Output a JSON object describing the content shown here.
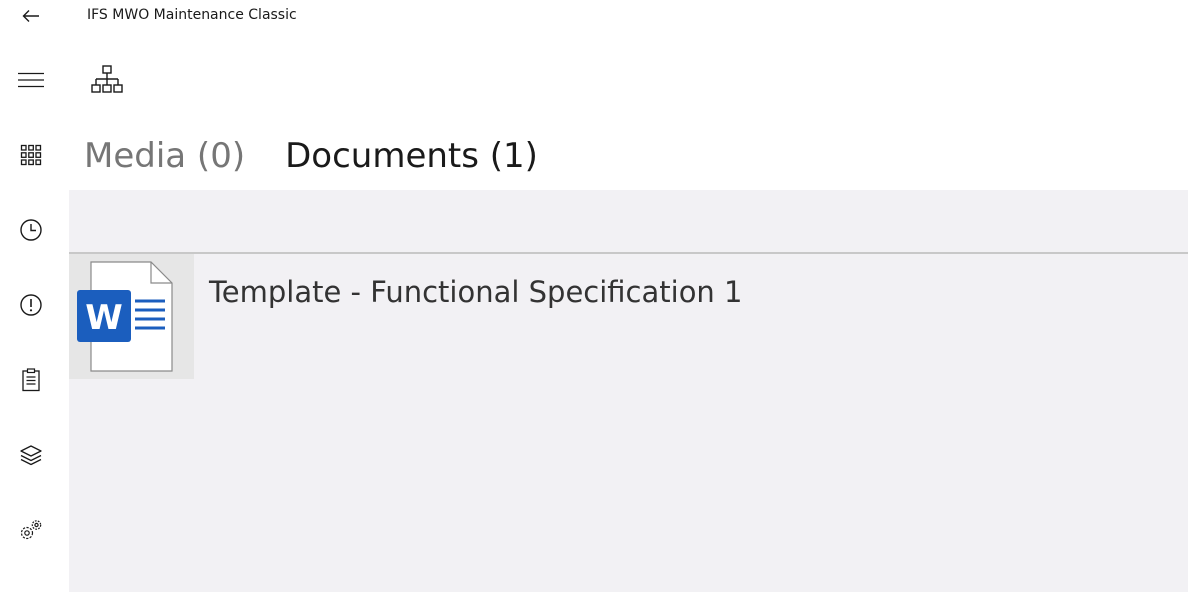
{
  "titlebar": {
    "title": "IFS MWO Maintenance Classic",
    "back_icon": "arrow-left-icon"
  },
  "nav_rail": {
    "items": [
      {
        "icon": "hamburger-menu-icon"
      },
      {
        "icon": "app-grid-icon"
      },
      {
        "icon": "clock-icon"
      },
      {
        "icon": "alert-circle-icon"
      },
      {
        "icon": "clipboard-icon"
      },
      {
        "icon": "layers-icon"
      },
      {
        "icon": "gears-icon"
      }
    ]
  },
  "toolbar": {
    "hierarchy_icon": "hierarchy-icon"
  },
  "tabs": [
    {
      "label": "Media (0)",
      "selected": false
    },
    {
      "label": "Documents (1)",
      "selected": true
    }
  ],
  "documents": [
    {
      "title": "Template - Functional Specification 1",
      "icon": "word-document-icon"
    }
  ],
  "colors": {
    "content_bg": "#f2f1f4",
    "word_blue": "#1b5ebe",
    "inactive_tab": "#767676"
  }
}
